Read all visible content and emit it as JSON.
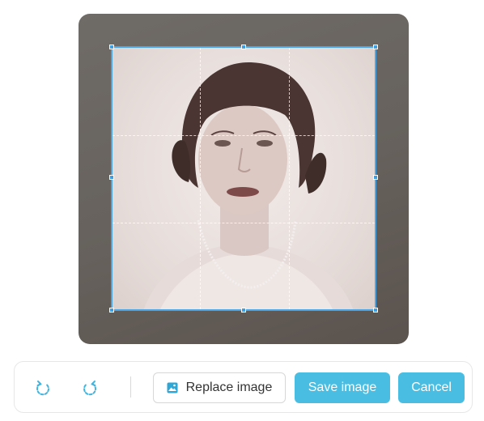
{
  "editor": {
    "image_subject": "vintage sepia portrait of a woman with short curled hair and pearl necklace",
    "crop_color": "#4aa6e6"
  },
  "toolbar": {
    "rotate_left_icon": "rotate-left-icon",
    "rotate_right_icon": "rotate-right-icon",
    "replace_label": "Replace image",
    "replace_icon": "image-icon",
    "save_label": "Save image",
    "cancel_label": "Cancel",
    "primary_color": "#49bde2"
  }
}
